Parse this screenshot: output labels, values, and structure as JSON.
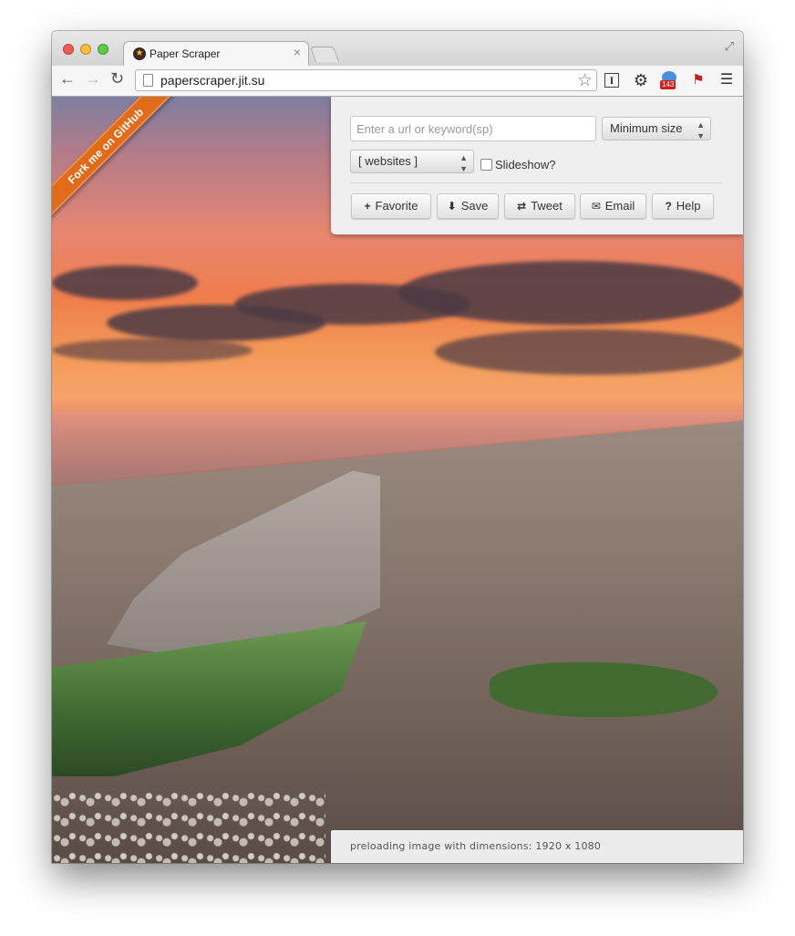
{
  "browser": {
    "tab_title": "Paper Scraper",
    "tab_close": "×",
    "url": "paperscraper.jit.su",
    "extension_badge": "143",
    "icons": [
      "back-icon",
      "forward-icon",
      "reload-icon",
      "bookmark-star-icon",
      "instapaper-icon",
      "gear-icon",
      "extension-icon",
      "extension-flag-icon",
      "menu-icon"
    ]
  },
  "ribbon": {
    "label": "Fork me on GitHub",
    "color": "#e06b1a"
  },
  "controls": {
    "search_placeholder": "Enter a url or keyword(sp)",
    "min_size_label": "Minimum size",
    "source_label": "[ websites ]",
    "slideshow_label": "Slideshow?",
    "slideshow_checked": false,
    "buttons": {
      "favorite": "Favorite",
      "save": "Save",
      "tweet": "Tweet",
      "email": "Email",
      "help": "Help"
    }
  },
  "status": {
    "text": "preloading image with dimensions: 1920 x 1080"
  }
}
